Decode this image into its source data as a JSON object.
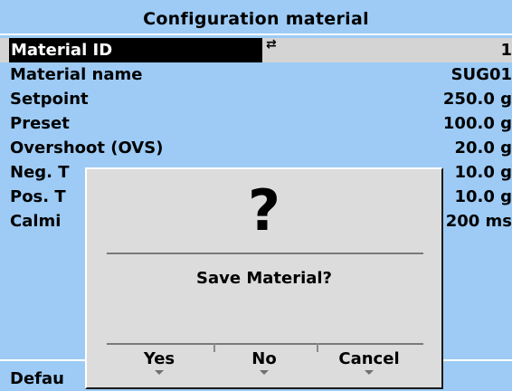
{
  "screen": {
    "title": "Configuration material",
    "rows": [
      {
        "label": "Material ID",
        "value": "1",
        "arrows": "⇄",
        "selected": true
      },
      {
        "label": "Material name",
        "value": "SUG01"
      },
      {
        "label": "Setpoint",
        "value": "250.0 g"
      },
      {
        "label": "Preset",
        "value": "100.0 g"
      },
      {
        "label": "Overshoot (OVS)",
        "value": "20.0 g"
      },
      {
        "label": "Neg. T",
        "value": "10.0 g"
      },
      {
        "label": "Pos. T",
        "value": "10.0 g"
      },
      {
        "label": "Calmi",
        "value": "200 ms"
      }
    ],
    "footer": "Defau"
  },
  "dialog": {
    "icon_glyph": "?",
    "icon": "question-mark-icon",
    "message": "Save Material?",
    "buttons": [
      {
        "label": "Yes"
      },
      {
        "label": "No"
      },
      {
        "label": "Cancel"
      }
    ]
  },
  "colors": {
    "background": "#9dcbf5",
    "dialog": "#dcdcdc",
    "selection": "#000000",
    "selection_row": "#d4d4d4"
  }
}
